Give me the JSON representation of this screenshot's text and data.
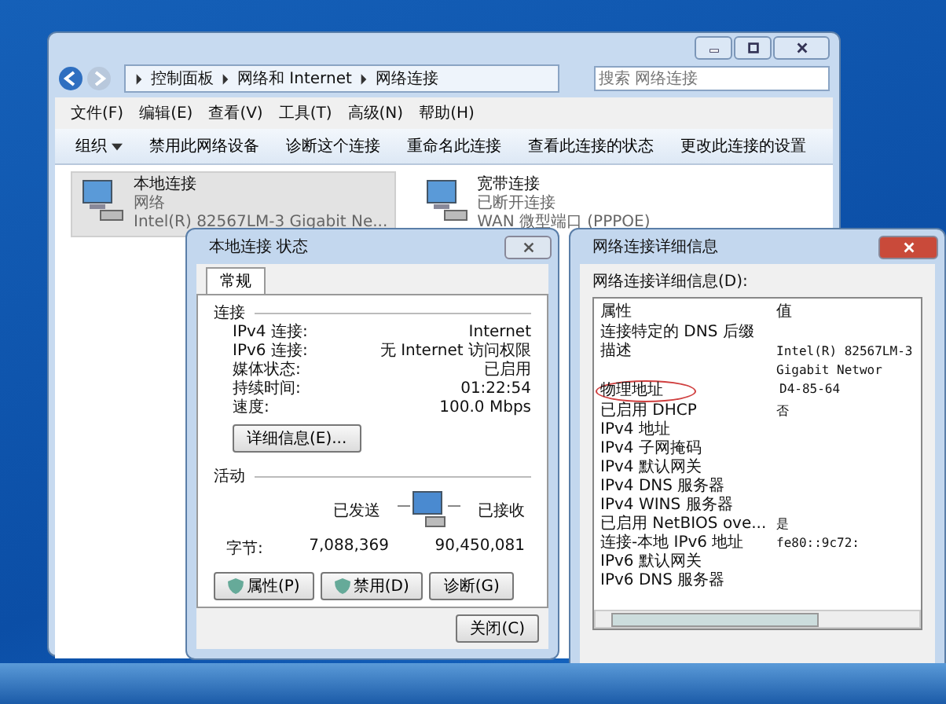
{
  "explorer": {
    "breadcrumb": [
      "控制面板",
      "网络和 Internet",
      "网络连接"
    ],
    "search": {
      "placeholder": "搜索 网络连接"
    },
    "menu": [
      "文件(F)",
      "编辑(E)",
      "查看(V)",
      "工具(T)",
      "高级(N)",
      "帮助(H)"
    ],
    "toolbar": [
      {
        "label": "组织",
        "kind": "dropdown"
      },
      {
        "label": "禁用此网络设备",
        "kind": "plain"
      },
      {
        "label": "诊断这个连接",
        "kind": "plain"
      },
      {
        "label": "重命名此连接",
        "kind": "plain"
      },
      {
        "label": "查看此连接的状态",
        "kind": "plain"
      },
      {
        "label": "更改此连接的设置",
        "kind": "plain"
      }
    ],
    "connections": [
      {
        "name": "本地连接",
        "status": "网络",
        "device": "Intel(R) 82567LM-3 Gigabit Ne...",
        "selected": true
      },
      {
        "name": "宽带连接",
        "status": "已断开连接",
        "device": "WAN 微型端口 (PPPOE)",
        "selected": false
      }
    ]
  },
  "status_dialog": {
    "title": "本地连接 状态",
    "tabs": [
      {
        "label": "常规",
        "selected": true
      }
    ],
    "connection_heading": "连接",
    "connection_rows": [
      {
        "label": "IPv4 连接:",
        "value": "Internet"
      },
      {
        "label": "IPv6 连接:",
        "value": "无 Internet 访问权限"
      },
      {
        "label": "媒体状态:",
        "value": "已启用"
      },
      {
        "label": "持续时间:",
        "value": "01:22:54"
      },
      {
        "label": "速度:",
        "value": "100.0 Mbps"
      }
    ],
    "details_button": "详细信息(E)...",
    "activity_heading": "活动",
    "sent_label": "已发送",
    "received_label": "已接收",
    "bytes_label": "字节:",
    "bytes_sent": "7,088,369",
    "bytes_received": "90,450,081",
    "buttons": [
      {
        "label": "属性(P)",
        "kind": "shield"
      },
      {
        "label": "禁用(D)",
        "kind": "shield"
      },
      {
        "label": "诊断(G)",
        "kind": "plain"
      }
    ],
    "close_button": "关闭(C)"
  },
  "details_dialog": {
    "title": "网络连接详细信息",
    "list_label": "网络连接详细信息(D):",
    "columns": [
      "属性",
      "值"
    ],
    "rows": [
      {
        "property": "连接特定的 DNS 后缀",
        "circled": false
      },
      {
        "property": "描述",
        "value": "Intel(R) 82567LM-3 Gigabit Networ",
        "circled": false
      },
      {
        "property": "物理地址",
        "value": "D4-85-64",
        "circled": true
      },
      {
        "property": "已启用 DHCP",
        "value": "否",
        "circled": false
      },
      {
        "property": "IPv4 地址",
        "circled": false
      },
      {
        "property": "IPv4 子网掩码",
        "circled": false
      },
      {
        "property": "IPv4 默认网关",
        "circled": false
      },
      {
        "property": "IPv4 DNS 服务器",
        "circled": false
      },
      {
        "property": "IPv4 WINS 服务器",
        "circled": false
      },
      {
        "property": "已启用 NetBIOS ove...",
        "value": "是",
        "circled": false
      },
      {
        "property": "连接-本地 IPv6 地址",
        "value": "fe80::9c72:",
        "circled": false
      },
      {
        "property": "IPv6 默认网关",
        "circled": false
      },
      {
        "property": "IPv6 DNS 服务器",
        "circled": false
      }
    ]
  }
}
